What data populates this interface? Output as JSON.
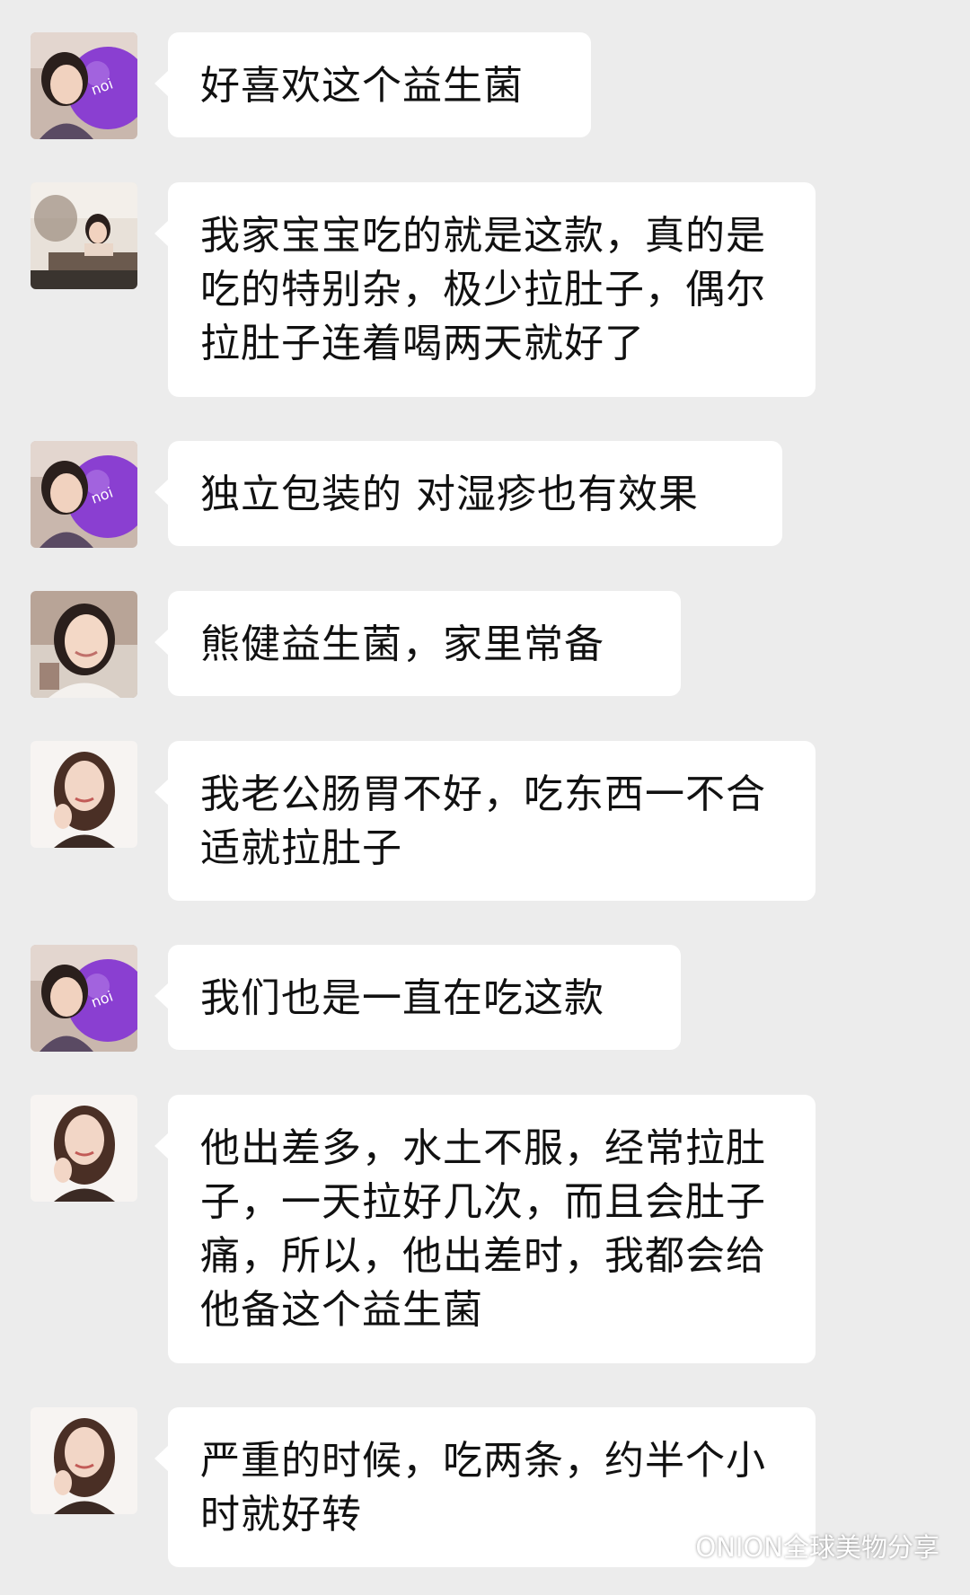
{
  "messages": [
    {
      "avatar": "balloon-woman",
      "text": "好喜欢这个益生菌"
    },
    {
      "avatar": "desk-woman",
      "text": "我家宝宝吃的就是这款，真的是吃的特别杂，极少拉肚子，偶尔拉肚子连着喝两天就好了"
    },
    {
      "avatar": "balloon-woman",
      "text": "独立包装的 对湿疹也有效果"
    },
    {
      "avatar": "smiling-woman",
      "text": "熊健益生菌，家里常备"
    },
    {
      "avatar": "portrait-woman",
      "text": "我老公肠胃不好，吃东西一不合适就拉肚子"
    },
    {
      "avatar": "balloon-woman",
      "text": "我们也是一直在吃这款"
    },
    {
      "avatar": "portrait-woman",
      "text": "他出差多，水土不服，经常拉肚子，一天拉好几次，而且会肚子痛，所以，他出差时，我都会给他备这个益生菌"
    },
    {
      "avatar": "portrait-woman",
      "text": "严重的时候，吃两条，约半个小时就好转"
    }
  ],
  "watermark": {
    "text": "ONION全球美物分享",
    "icon": "wechat-icon"
  },
  "colors": {
    "background": "#ececec",
    "bubble": "#ffffff",
    "text": "#111111",
    "balloon": "#8a3fd1"
  }
}
